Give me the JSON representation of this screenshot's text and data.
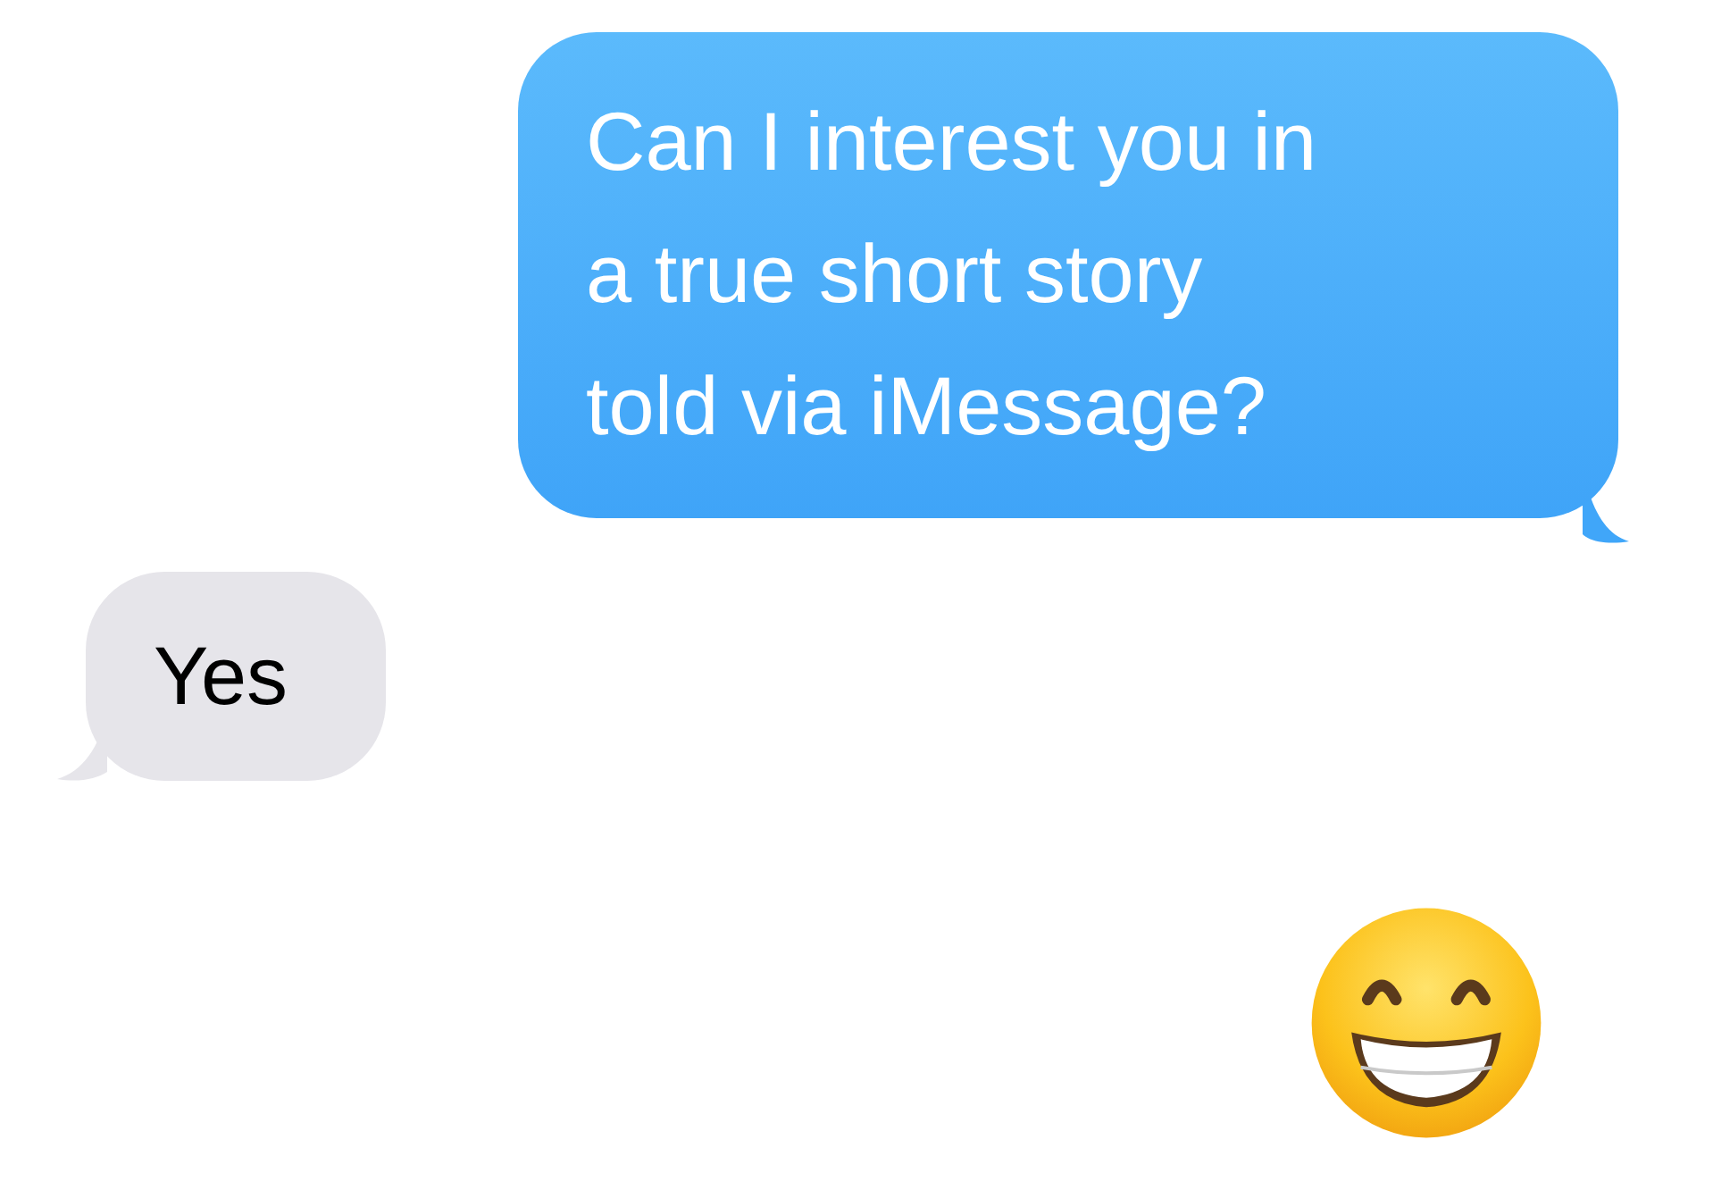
{
  "messages": [
    {
      "kind": "outgoing",
      "text": "Can I interest you in\na true short story\ntold via iMessage?"
    },
    {
      "kind": "incoming",
      "text": "Yes"
    },
    {
      "kind": "outgoing_emoji"
    }
  ]
}
